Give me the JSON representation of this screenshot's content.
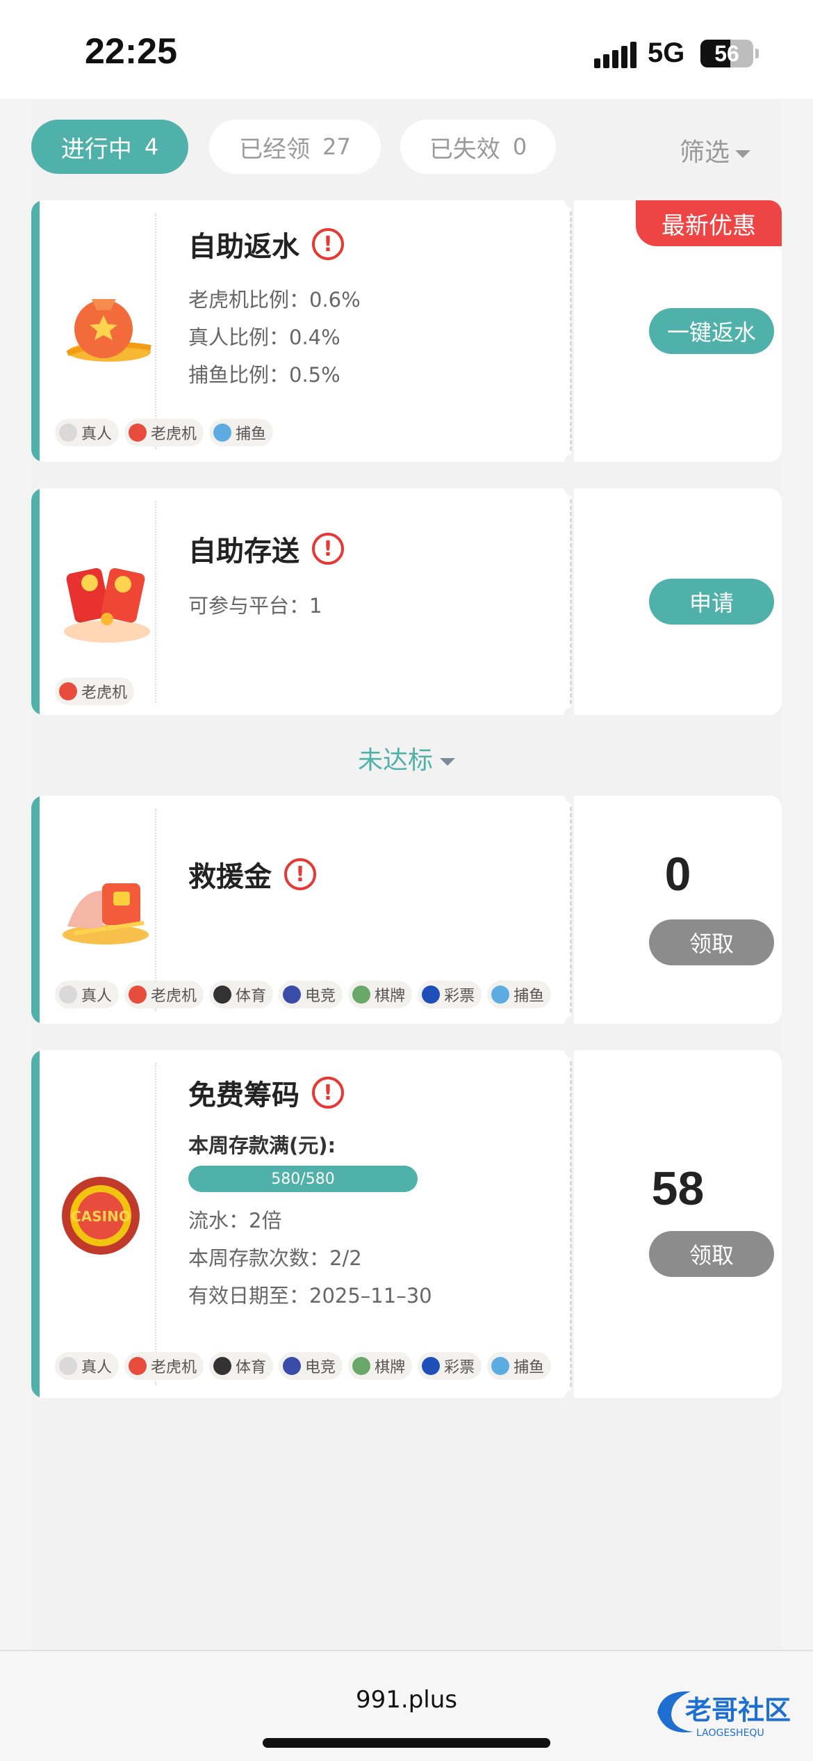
{
  "status_bar": {
    "time": "22:25",
    "network": "5G",
    "battery": "56",
    "battery_level": 0.56
  },
  "tabs": [
    {
      "label": "进行中",
      "count": "4"
    },
    {
      "label": "已经领",
      "count": "27"
    },
    {
      "label": "已失效",
      "count": "0"
    }
  ],
  "filter_label": "筛选",
  "cards": [
    {
      "title": "自助返水",
      "ribbon": "最新优惠",
      "lines": [
        "老虎机比例：0.6%",
        "真人比例：0.4%",
        "捕鱼比例：0.5%"
      ],
      "tags": [
        "真人",
        "老虎机",
        "捕鱼"
      ],
      "button": "一键返水"
    },
    {
      "title": "自助存送",
      "lines": [
        "可参与平台：1"
      ],
      "tags": [
        "老虎机"
      ],
      "button": "申请"
    },
    {
      "title": "救援金",
      "amount": "0",
      "tags": [
        "真人",
        "老虎机",
        "体育",
        "电竞",
        "棋牌",
        "彩票",
        "捕鱼"
      ],
      "button": "领取"
    },
    {
      "title": "免费筹码",
      "deposit_label": "本周存款满(元):",
      "progress_text": "580/580",
      "progress_value": 1.0,
      "lines": [
        "流水：2倍",
        "本周存款次数：2/2",
        "有效日期至：2025–11–30"
      ],
      "amount": "58",
      "tags": [
        "真人",
        "老虎机",
        "体育",
        "电竞",
        "棋牌",
        "彩票",
        "捕鱼"
      ],
      "button": "领取"
    }
  ],
  "unmet_label": "未达标",
  "footer": {
    "url": "991.plus",
    "watermark": "老哥社区 LAOGESHEQU"
  },
  "colors": {
    "accent": "#4fb1a9",
    "ribbon": "#ef4444",
    "warning": "#e53935",
    "disabled_button": "#8c8c8c"
  }
}
